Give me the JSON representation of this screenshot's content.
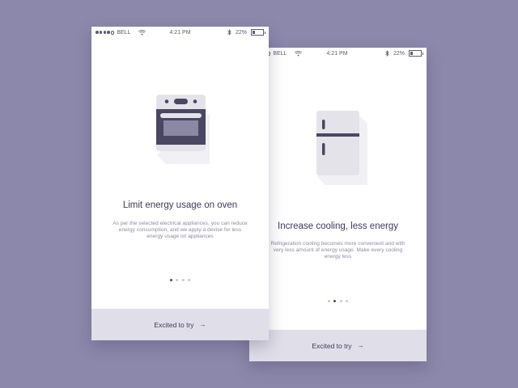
{
  "screens": [
    {
      "status": {
        "carrier": "BELL",
        "time": "4:21 PM",
        "battery": "22%"
      },
      "title": "Limit energy usage on oven",
      "description": "As per the selected electrical appliances, you can reduce energy consumption, and we apply a devise for less energy usage on appliances",
      "cta": "Excited to try",
      "arrow": "→",
      "page_index": 1,
      "page_count": 4,
      "illustration": "oven-icon"
    },
    {
      "status": {
        "carrier": "BELL",
        "time": "4:21 PM",
        "battery": "22%"
      },
      "title": "Increase cooling, less energy",
      "description": "Refrigeration cooling becomes more convenient and with very less amount of energy usage. Make every cooling energy less",
      "cta": "Excited to try",
      "arrow": "→",
      "page_index": 2,
      "page_count": 4,
      "illustration": "fridge-icon"
    }
  ],
  "colors": {
    "background": "#8c88ab",
    "card": "#ffffff",
    "cta_bar": "#e0dee9",
    "text_dark": "#3d3a58",
    "text_muted": "#8e8aa5",
    "appliance_body": "#e5e3ea",
    "appliance_dark": "#4a4763"
  }
}
